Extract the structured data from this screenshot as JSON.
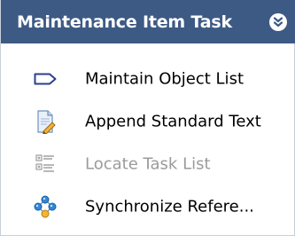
{
  "header": {
    "title": "Maintenance Item Task",
    "background": "#3d5a84",
    "collapse_icon": "double-chevron-down-icon"
  },
  "menu": {
    "items": [
      {
        "label": "Maintain Object List",
        "icon": "object-list-tag-icon",
        "enabled": true
      },
      {
        "label": "Append Standard Text",
        "icon": "document-edit-icon",
        "enabled": true
      },
      {
        "label": "Locate Task List",
        "icon": "task-list-tree-icon",
        "enabled": false
      },
      {
        "label": "Synchronize Refere...",
        "icon": "synchronize-nodes-icon",
        "enabled": true
      }
    ],
    "disabled_text_color": "#9b9b9b"
  }
}
